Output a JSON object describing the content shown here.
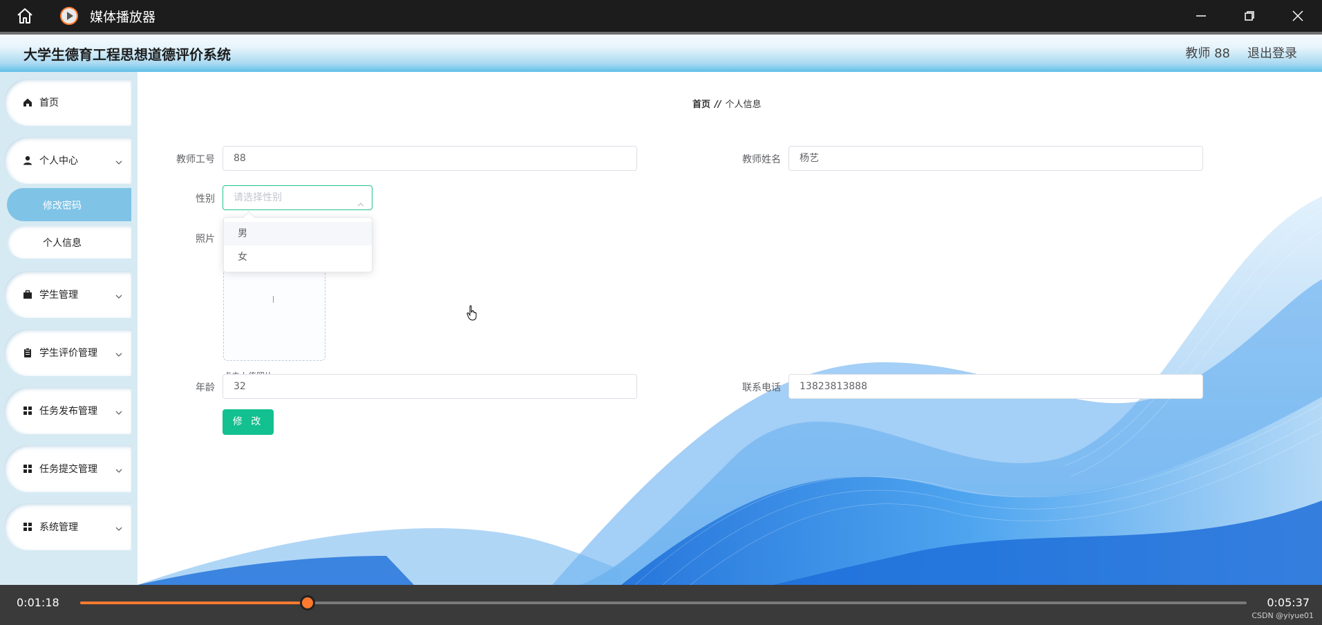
{
  "window": {
    "title": "媒体播放器",
    "home_icon": "home-icon",
    "app_icon": "play-circle-icon",
    "controls": [
      "minimize-icon",
      "restore-icon",
      "close-icon"
    ]
  },
  "header": {
    "title": "大学生德育工程思想道德评价系统",
    "user": "教师 88",
    "logout": "退出登录"
  },
  "sidebar": {
    "items": [
      {
        "label": "首页",
        "icon": "home-icon"
      },
      {
        "label": "个人中心",
        "icon": "user-icon",
        "expanded": true,
        "children": [
          {
            "label": "修改密码",
            "active": true
          },
          {
            "label": "个人信息",
            "active": false
          }
        ]
      },
      {
        "label": "学生管理",
        "icon": "briefcase-icon"
      },
      {
        "label": "学生评价管理",
        "icon": "clipboard-icon"
      },
      {
        "label": "任务发布管理",
        "icon": "grid-icon"
      },
      {
        "label": "任务提交管理",
        "icon": "grid-icon"
      },
      {
        "label": "系统管理",
        "icon": "grid-icon"
      }
    ]
  },
  "breadcrumb": {
    "home": "首页",
    "separator": "//",
    "current": "个人信息"
  },
  "form": {
    "teacher_id": {
      "label": "教师工号",
      "value": "88"
    },
    "teacher_name": {
      "label": "教师姓名",
      "value": "杨艺"
    },
    "gender": {
      "label": "性别",
      "placeholder": "请选择性别",
      "options": [
        "男",
        "女"
      ],
      "hovered": "男"
    },
    "photo": {
      "label": "照片",
      "tip": "点击上传照片"
    },
    "age": {
      "label": "年龄",
      "value": "32"
    },
    "phone": {
      "label": "联系电话",
      "value": "13823813888"
    },
    "submit": "修 改"
  },
  "player": {
    "current_time": "0:01:18",
    "total_time": "0:05:37",
    "progress": 0.195,
    "watermark": "CSDN @yiyue01",
    "accent": "#ff7a2f"
  },
  "colors": {
    "primary": "#13c08f",
    "sidebar_active": "#7fc3e6",
    "header_gradient_end": "#5fbfe8"
  }
}
